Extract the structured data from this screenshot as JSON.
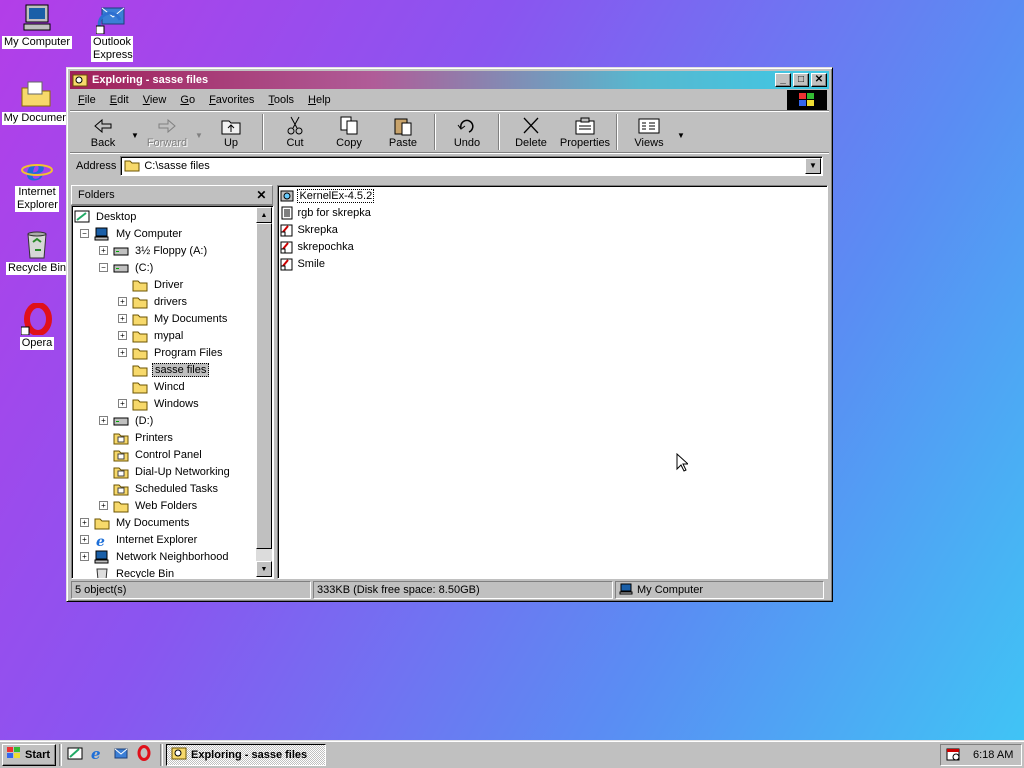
{
  "desktop": {
    "icons": [
      {
        "label": "My Computer",
        "icon": "my-computer-icon"
      },
      {
        "label": "Outlook Express",
        "icon": "outlook-express-icon"
      },
      {
        "label": "My Documen",
        "icon": "my-documents-icon"
      },
      {
        "label": "Internet Explorer",
        "icon": "internet-explorer-icon"
      },
      {
        "label": "Recycle Bin",
        "icon": "recycle-bin-icon"
      },
      {
        "label": "Opera",
        "icon": "opera-icon"
      }
    ]
  },
  "window": {
    "title": "Exploring - sasse files",
    "controls": {
      "minimize": "_",
      "maximize": "□",
      "close": "✕"
    }
  },
  "menu": {
    "items": [
      {
        "label": "File",
        "u": "F",
        "rest": "ile"
      },
      {
        "label": "Edit",
        "u": "E",
        "rest": "dit"
      },
      {
        "label": "View",
        "u": "V",
        "rest": "iew"
      },
      {
        "label": "Go",
        "u": "G",
        "rest": "o"
      },
      {
        "label": "Favorites",
        "u": "F",
        "rest": "avorites"
      },
      {
        "label": "Tools",
        "u": "T",
        "rest": "ools"
      },
      {
        "label": "Help",
        "u": "H",
        "rest": "elp"
      }
    ]
  },
  "toolbar": {
    "back": "Back",
    "forward": "Forward",
    "up": "Up",
    "cut": "Cut",
    "copy": "Copy",
    "paste": "Paste",
    "undo": "Undo",
    "delete": "Delete",
    "properties": "Properties",
    "views": "Views"
  },
  "address": {
    "label": "Address",
    "value": "C:\\sasse files"
  },
  "folders": {
    "header": "Folders",
    "close": "✕",
    "tree": [
      {
        "label": "Desktop",
        "level": 0,
        "expander": "",
        "icon": "desktop-icon"
      },
      {
        "label": "My Computer",
        "level": 1,
        "expander": "−",
        "icon": "my-computer-icon"
      },
      {
        "label": "3½ Floppy (A:)",
        "level": 2,
        "expander": "+",
        "icon": "floppy-icon"
      },
      {
        "label": "(C:)",
        "level": 2,
        "expander": "−",
        "icon": "hard-drive-icon"
      },
      {
        "label": "Driver",
        "level": 3,
        "expander": "",
        "icon": "folder-icon"
      },
      {
        "label": "drivers",
        "level": 3,
        "expander": "+",
        "icon": "folder-icon"
      },
      {
        "label": "My Documents",
        "level": 3,
        "expander": "+",
        "icon": "my-documents-folder-icon"
      },
      {
        "label": "mypal",
        "level": 3,
        "expander": "+",
        "icon": "folder-icon"
      },
      {
        "label": "Program Files",
        "level": 3,
        "expander": "+",
        "icon": "folder-icon"
      },
      {
        "label": "sasse files",
        "level": 3,
        "expander": "",
        "icon": "open-folder-icon",
        "selected": true
      },
      {
        "label": "Wincd",
        "level": 3,
        "expander": "",
        "icon": "folder-icon"
      },
      {
        "label": "Windows",
        "level": 3,
        "expander": "+",
        "icon": "folder-icon"
      },
      {
        "label": "(D:)",
        "level": 2,
        "expander": "+",
        "icon": "cd-drive-icon"
      },
      {
        "label": "Printers",
        "level": 2,
        "expander": "",
        "icon": "printers-icon"
      },
      {
        "label": "Control Panel",
        "level": 2,
        "expander": "",
        "icon": "control-panel-icon"
      },
      {
        "label": "Dial-Up Networking",
        "level": 2,
        "expander": "",
        "icon": "dialup-icon"
      },
      {
        "label": "Scheduled Tasks",
        "level": 2,
        "expander": "",
        "icon": "scheduled-tasks-icon"
      },
      {
        "label": "Web Folders",
        "level": 2,
        "expander": "+",
        "icon": "web-folders-icon"
      },
      {
        "label": "My Documents",
        "level": 1,
        "expander": "+",
        "icon": "my-documents-folder-icon"
      },
      {
        "label": "Internet Explorer",
        "level": 1,
        "expander": "+",
        "icon": "internet-explorer-icon"
      },
      {
        "label": "Network Neighborhood",
        "level": 1,
        "expander": "+",
        "icon": "network-icon"
      },
      {
        "label": "Recycle Bin",
        "level": 1,
        "expander": "",
        "icon": "recycle-bin-icon"
      }
    ]
  },
  "files": [
    {
      "name": "KernelEx-4.5.2",
      "icon": "installer-icon",
      "focused": true
    },
    {
      "name": "rgb for skrepka",
      "icon": "text-file-icon"
    },
    {
      "name": "Skrepka",
      "icon": "shortcut-app-icon"
    },
    {
      "name": "skrepochka",
      "icon": "shortcut-app-icon"
    },
    {
      "name": "Smile",
      "icon": "shortcut-app-icon"
    }
  ],
  "status": {
    "objects": "5 object(s)",
    "size": "333KB (Disk free space: 8.50GB)",
    "location": "My Computer"
  },
  "taskbar": {
    "start": "Start",
    "task": "Exploring - sasse files",
    "clock": "6:18 AM"
  }
}
